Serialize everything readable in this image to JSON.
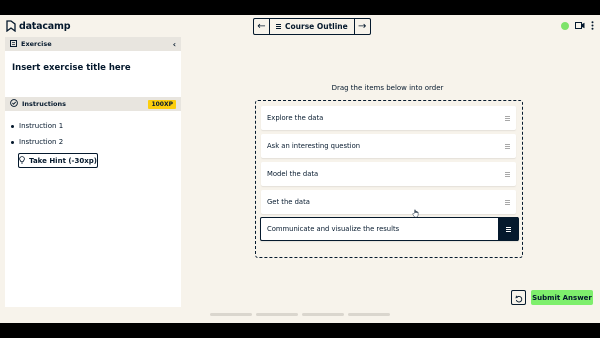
{
  "app": {
    "logo_text": "datacamp"
  },
  "course_nav": {
    "label": "Course Outline"
  },
  "left_panel": {
    "header_label": "Exercise",
    "exercise_title": "Insert exercise title here",
    "instructions_label": "Instructions",
    "xp_badge": "100XP",
    "instructions": [
      "Instruction 1",
      "Instruction 2"
    ],
    "hint_label": "Take Hint (-30xp)"
  },
  "main": {
    "drag_title": "Drag the items below into order",
    "items": [
      "Explore the data",
      "Ask an interesting question",
      "Model the data",
      "Get the data",
      "Communicate and visualize the results"
    ],
    "submit_label": "Submit Answer"
  },
  "colors": {
    "background": "#f7f3eb",
    "navy": "#05192d",
    "submit_green": "#7eef6c",
    "status_green": "#7ee36a",
    "xp_yellow": "#fcce0d"
  },
  "icons": [
    "datacamp-logo-icon",
    "arrow-left-icon",
    "menu-icon",
    "arrow-right-icon",
    "status-dot-icon",
    "video-icon",
    "more-icon",
    "exercise-icon",
    "collapse-chevron-icon",
    "check-circle-icon",
    "bulb-icon",
    "drag-handle-icon",
    "reset-icon",
    "cursor-hand-icon"
  ]
}
